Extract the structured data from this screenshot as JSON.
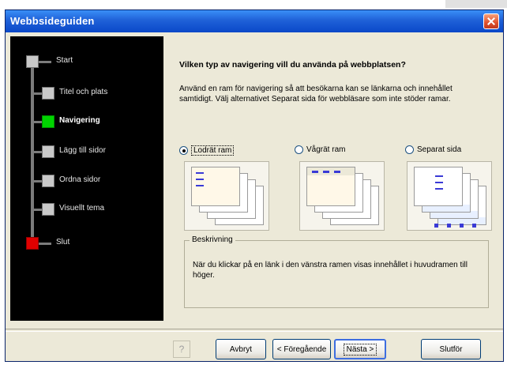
{
  "window": {
    "title": "Webbsideguiden"
  },
  "steps": [
    {
      "label": "Start",
      "color": "#c9c9c9",
      "active": false,
      "terminal": true
    },
    {
      "label": "Titel och plats",
      "color": "#c9c9c9",
      "active": false
    },
    {
      "label": "Navigering",
      "color": "#00c400",
      "active": true
    },
    {
      "label": "Lägg till sidor",
      "color": "#c9c9c9",
      "active": false
    },
    {
      "label": "Ordna sidor",
      "color": "#c9c9c9",
      "active": false
    },
    {
      "label": "Visuellt tema",
      "color": "#c9c9c9",
      "active": false
    },
    {
      "label": "Slut",
      "color": "#e00000",
      "active": false,
      "terminal": true
    }
  ],
  "main": {
    "question": "Vilken typ av navigering vill du använda på webbplatsen?",
    "description": "Använd en ram för navigering så att besökarna kan se länkarna och innehållet samtidigt. Välj alternativet Separat sida för webbläsare som inte stöder ramar.",
    "options": [
      {
        "label": "Lodrät ram",
        "selected": true
      },
      {
        "label": "Vågrät ram",
        "selected": false
      },
      {
        "label": "Separat sida",
        "selected": false
      }
    ],
    "description_group": {
      "legend": "Beskrivning",
      "text": "När du klickar på en länk i den vänstra ramen visas innehållet i huvudramen till höger."
    }
  },
  "buttons": {
    "help": "?",
    "cancel": "Avbryt",
    "back": "< Föregående",
    "next": "Nästa >",
    "finish": "Slutför"
  }
}
